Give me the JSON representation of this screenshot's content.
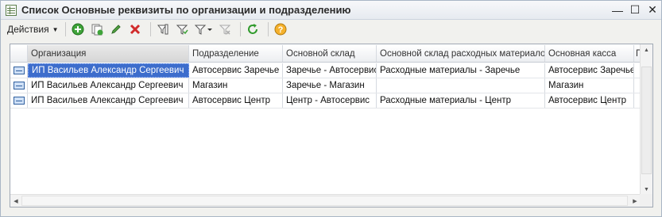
{
  "window": {
    "title": "Список Основные реквизиты по организации и подразделению",
    "minimize": "—",
    "maximize": "☐",
    "close": "✕"
  },
  "toolbar": {
    "actions_label": "Действия",
    "buttons": [
      "add-icon",
      "copy-icon",
      "edit-icon",
      "delete-icon",
      "filter-set-icon",
      "filter-icon",
      "filter-dropdown-icon",
      "filter-clear-icon",
      "refresh-icon",
      "help-icon"
    ]
  },
  "table": {
    "headers": [
      "Организация",
      "Подразделение",
      "Основной склад",
      "Основной склад расходных материалов",
      "Основная касса",
      "П"
    ],
    "rows": [
      [
        "ИП Васильев Александр Сергеевич",
        "Автосервис Заречье",
        "Заречье - Автосервис",
        "Расходные материалы - Заречье",
        "Автосервис Заречье"
      ],
      [
        "ИП Васильев Александр Сергеевич",
        "Магазин",
        "Заречье - Магазин",
        "",
        "Магазин"
      ],
      [
        "ИП Васильев Александр Сергеевич",
        "Автосервис Центр",
        "Центр - Автосервис",
        "Расходные материалы - Центр",
        "Автосервис Центр"
      ]
    ]
  },
  "colors": {
    "selection": "#3d6dcc",
    "header_sorted": "#d6d6d6"
  }
}
